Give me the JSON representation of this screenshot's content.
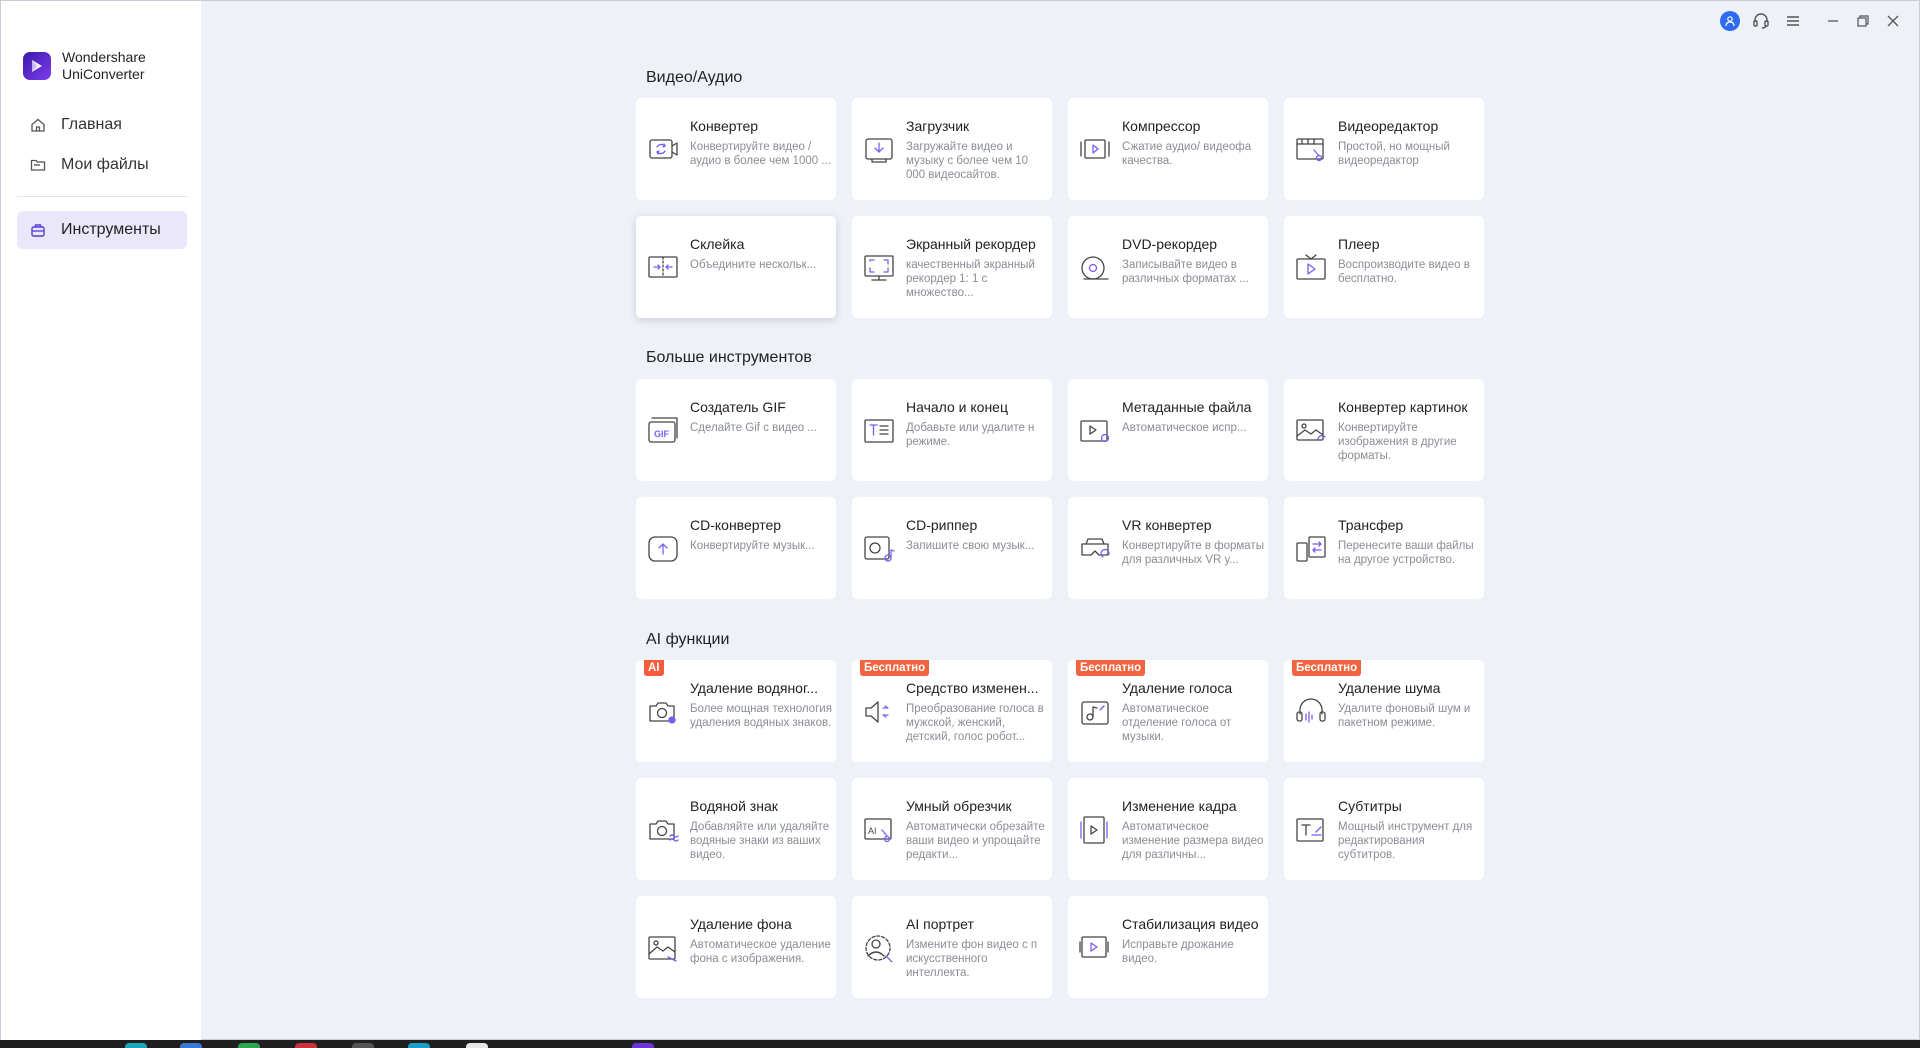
{
  "app": {
    "brand_line1": "Wondershare",
    "brand_line2": "UniConverter",
    "accent": "#5b3fd6"
  },
  "sidebar": {
    "items": [
      {
        "label": "Главная",
        "icon": "home-icon"
      },
      {
        "label": "Мои файлы",
        "icon": "folder-icon"
      },
      {
        "label": "Инструменты",
        "icon": "toolbox-icon",
        "active": true
      }
    ]
  },
  "titlebar": {
    "icons": [
      "account-icon",
      "support-headset-icon",
      "menu-icon",
      "minimize-icon",
      "restore-icon",
      "close-icon"
    ]
  },
  "sections": [
    {
      "title": "Видео/Аудио"
    },
    {
      "title": "Больше инструментов"
    },
    {
      "title": "AI функции"
    }
  ],
  "cards": [
    {
      "title": "Конвертер",
      "desc": "Конвертируйте видео / аудио в более чем 1000 ...",
      "icon": "convert-icon"
    },
    {
      "title": "Загрузчик",
      "desc": "Загружайте видео и музыку с более чем 10 000 видеосайтов.",
      "icon": "download-icon"
    },
    {
      "title": "Компрессор",
      "desc": "Сжатие аудио/ видеофа качества.",
      "icon": "compress-icon"
    },
    {
      "title": "Видеоредактор",
      "desc": "Простой, но мощный видеоредактор",
      "icon": "video-edit-icon"
    },
    {
      "title": "Склейка",
      "desc": "Объедините нескольк...",
      "icon": "merge-icon"
    },
    {
      "title": "Экранный рекордер",
      "desc": "качественный экранный рекордер 1: 1 с множество...",
      "icon": "screen-record-icon"
    },
    {
      "title": "DVD-рекордер",
      "desc": "Записывайте видео в различных форматах ...",
      "icon": "dvd-icon"
    },
    {
      "title": "Плеер",
      "desc": "Воспроизводите видео в бесплатно.",
      "icon": "player-icon"
    },
    {
      "title": "Создатель GIF",
      "desc": "Сделайте Gif с видео ...",
      "icon": "gif-icon"
    },
    {
      "title": "Начало и конец",
      "desc": "Добавьте или удалите н режиме.",
      "icon": "intro-outro-icon"
    },
    {
      "title": "Метаданные файла",
      "desc": "Автоматическое испр...",
      "icon": "metadata-icon"
    },
    {
      "title": "Конвертер картинок",
      "desc": "Конвертируйте изображения в другие форматы.",
      "icon": "image-convert-icon"
    },
    {
      "title": "CD-конвертер",
      "desc": "Конвертируйте музык...",
      "icon": "cd-convert-icon"
    },
    {
      "title": "CD-риппер",
      "desc": "Запишите свою музык...",
      "icon": "cd-rip-icon"
    },
    {
      "title": "VR конвертер",
      "desc": "Конвертируйте в форматы для различных VR у...",
      "icon": "vr-icon"
    },
    {
      "title": "Трансфер",
      "desc": "Перенесите ваши файлы на другое устройство.",
      "icon": "transfer-icon"
    },
    {
      "title": "Удаление водяног...",
      "desc": "Более мощная технология удаления водяных знаков.",
      "icon": "watermark-remove-icon",
      "badge": "AI",
      "badge_type": "ai"
    },
    {
      "title": "Средство изменен...",
      "desc": "Преобразование голоса в мужской, женский, детский, голос робот...",
      "icon": "voice-change-icon",
      "badge": "Бесплатно",
      "badge_type": "free"
    },
    {
      "title": "Удаление голоса",
      "desc": "Автоматическое отделение голоса от музыки.",
      "icon": "vocal-remove-icon",
      "badge": "Бесплатно",
      "badge_type": "free"
    },
    {
      "title": "Удаление шума",
      "desc": "Удалите фоновый шум и пакетном режиме.",
      "icon": "noise-remove-icon",
      "badge": "Бесплатно",
      "badge_type": "free"
    },
    {
      "title": "Водяной знак",
      "desc": "Добавляйте или удаляйте водяные знаки из ваших видео.",
      "icon": "watermark-icon"
    },
    {
      "title": "Умный обрезчик",
      "desc": "Автоматически обрезайте ваши видео и упрощайте редакти...",
      "icon": "smart-trim-icon"
    },
    {
      "title": "Изменение кадра",
      "desc": "Автоматическое изменение размера видео для различны...",
      "icon": "reframe-icon"
    },
    {
      "title": "Субтитры",
      "desc": "Мощный инструмент для редактирования субтитров.",
      "icon": "subtitle-icon"
    },
    {
      "title": "Удаление фона",
      "desc": "Автоматическое удаление фона с изображения.",
      "icon": "bg-remove-icon"
    },
    {
      "title": "AI портрет",
      "desc": "Измените фон видео с п искусственного интеллекта.",
      "icon": "ai-portrait-icon"
    },
    {
      "title": "Стабилизация видео",
      "desc": "Исправьте дрожание видео.",
      "icon": "stabilize-icon"
    }
  ]
}
